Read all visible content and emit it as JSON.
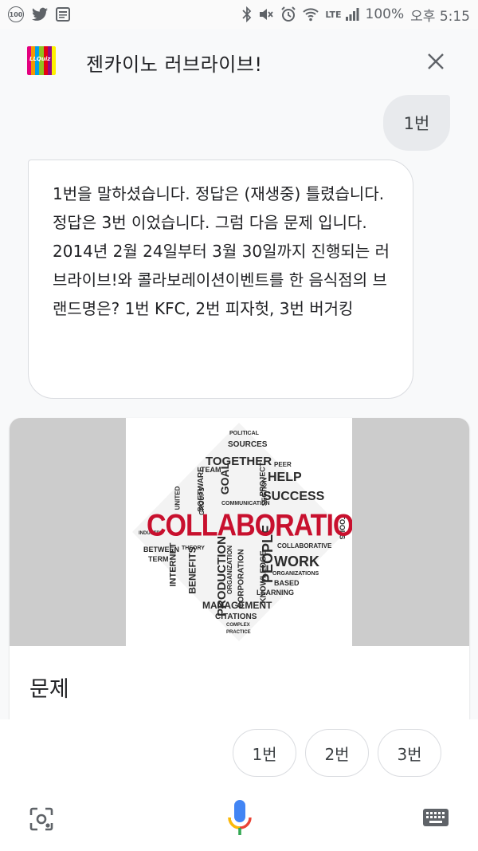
{
  "status_bar": {
    "badge": "100",
    "network": "LTE",
    "battery": "100%",
    "time": "오후 5:15"
  },
  "header": {
    "app_title": "젠카이노 러브라이브!",
    "logo_text": "LLQuiz",
    "logo_colors": [
      "#e4007f",
      "#f39800",
      "#00a0e9",
      "#8fc31f",
      "#e60012",
      "#920783",
      "#fff100"
    ],
    "close_icon": "close-icon"
  },
  "conversation": {
    "user_message": "1번",
    "assistant_message": "1번을 말하셨습니다. 정답은 (재생중) 틀렸습니다. 정답은 3번 이었습니다.  그럼 다음 문제 입니다. 2014년 2월 24일부터 3월 30일까지 진행되는 러브라이브!와 콜라보레이션이벤트를 한 음식점의 브랜드명은? 1번 KFC, 2번 피자헛, 3번 버거킹"
  },
  "card": {
    "title": "문제",
    "image": {
      "main_word": "COLLABORATION",
      "words": [
        "POLITICAL",
        "SOURCES",
        "TOGETHER",
        "HELP",
        "GOAL",
        "SUCCESS",
        "SOFTWARE",
        "UNITED",
        "GROUPS",
        "COMMUNICATION",
        "PROJECT",
        "TOOLS",
        "INDUSTRY",
        "BETWEEN",
        "TERM",
        "THEORY",
        "INTERNET",
        "BENEFITS",
        "PRODUCTION",
        "PEOPLE",
        "WORK",
        "COLLABORATIVE",
        "CORPORATION",
        "KNOWLEDGE",
        "ORGANIZATIONS",
        "BASED",
        "LEARNING",
        "MANAGEMENT",
        "CITATIONS",
        "COMPLEX",
        "PRACTICE",
        "ORGANIZATION",
        "SECTION",
        "TEAM",
        "PEER"
      ]
    }
  },
  "suggestions": [
    "1번",
    "2번",
    "3번"
  ],
  "bottom_bar": {
    "lens_icon": "lens-icon",
    "mic_icon": "mic-icon",
    "keyboard_icon": "keyboard-icon"
  }
}
